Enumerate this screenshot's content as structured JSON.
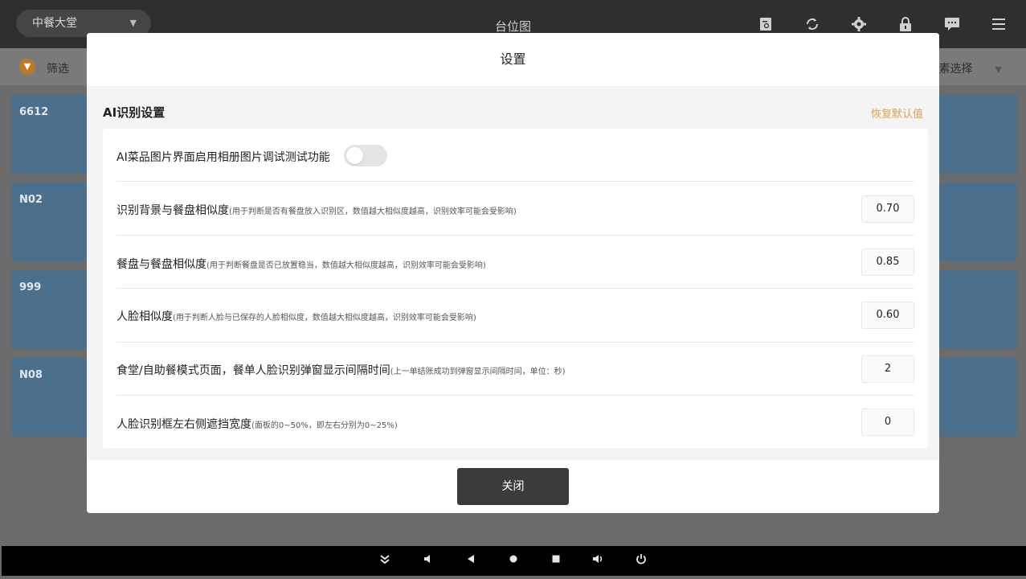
{
  "app": {
    "area": "中餐大堂",
    "title": "台位图",
    "filter_label": "筛选",
    "element_select": "元素选择",
    "tiles_left": [
      "6612",
      "N02",
      "999",
      "N08"
    ]
  },
  "modal": {
    "title": "设置",
    "section_title": "AI识别设置",
    "restore_label": "恢复默认值",
    "toggle_row": {
      "label": "AI菜品图片界面启用相册图片调试测试功能",
      "enabled": false
    },
    "rows": [
      {
        "label": "识别背景与餐盘相似度",
        "hint": "(用于判断是否有餐盘放入识别区，数值越大相似度越高，识别效率可能会受影响)",
        "value": "0.70"
      },
      {
        "label": "餐盘与餐盘相似度",
        "hint": "(用于判断餐盘是否已放置稳当，数值越大相似度越高，识别效率可能会受影响)",
        "value": "0.85"
      },
      {
        "label": "人脸相似度",
        "hint": "(用于判断人脸与已保存的人脸相似度，数值越大相似度越高，识别效率可能会受影响)",
        "value": "0.60"
      },
      {
        "label": "食堂/自助餐模式页面，餐单人脸识别弹窗显示间隔时间",
        "hint": "(上一单结账成功到弹窗显示间隔时间，单位：秒)",
        "value": "2"
      },
      {
        "label": "人脸识别框左右侧遮挡宽度",
        "hint": "(面板的0~50%，即左右分别为0~25%)",
        "value": "0"
      }
    ],
    "close_label": "关闭"
  },
  "icons": {
    "top": [
      "search-doc-icon",
      "refresh-icon",
      "gear-icon",
      "lock-icon",
      "message-icon",
      "menu-icon"
    ],
    "nav": [
      "collapse-icon",
      "volume-down-icon",
      "back-icon",
      "home-icon",
      "recents-icon",
      "volume-up-icon",
      "power-icon"
    ]
  },
  "colors": {
    "accent": "#d8a256",
    "tile": "#4c6f8c",
    "button": "#3b3b3b"
  }
}
